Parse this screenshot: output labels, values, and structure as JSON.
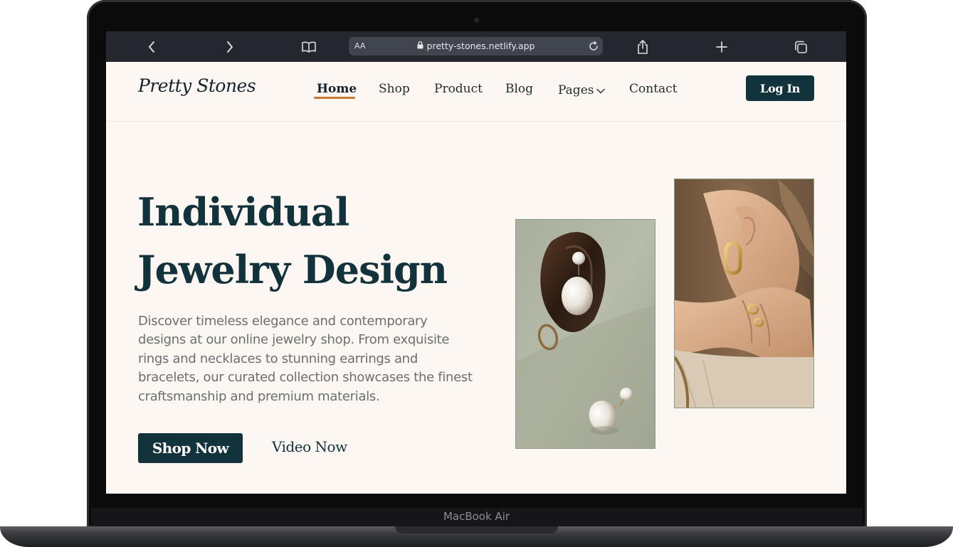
{
  "device": {
    "label": "MacBook Air"
  },
  "browser": {
    "text_size_label": "AA",
    "url": "pretty-stones.netlify.app",
    "icons": [
      "chevron-left-icon",
      "chevron-right-icon",
      "book-icon",
      "lock-icon",
      "reload-icon",
      "share-icon",
      "plus-icon",
      "tabs-icon"
    ]
  },
  "site": {
    "logo": "Pretty Stones",
    "nav": [
      {
        "label": "Home",
        "active": true
      },
      {
        "label": "Shop"
      },
      {
        "label": "Product"
      },
      {
        "label": "Blog"
      },
      {
        "label": "Pages"
      },
      {
        "label": "Contact"
      }
    ],
    "login_label": "Log In"
  },
  "hero": {
    "title_line1": "Individual",
    "title_line2": "Jewelry Design",
    "description": "Discover timeless elegance and contemporary designs at our online jewelry shop. From exquisite rings and necklaces to stunning earrings and bracelets, our curated collection showcases the finest craftsmanship and premium materials.",
    "primary_cta": "Shop Now",
    "secondary_cta": "Video Now"
  },
  "colors": {
    "brand_dark": "#12323c",
    "accent_underline": "#c27a2c",
    "page_bg": "#fcf7f2"
  }
}
